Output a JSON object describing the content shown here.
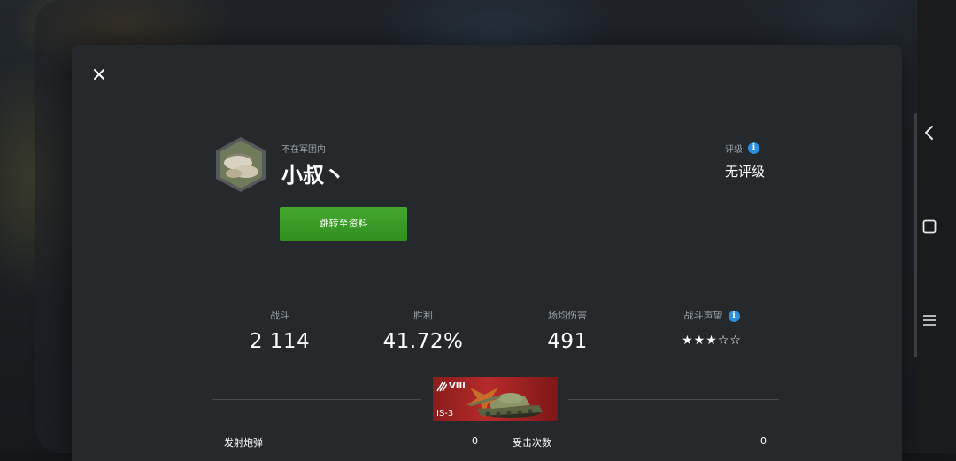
{
  "profile": {
    "clan_status": "不在军团内",
    "player_name": "小叔丶",
    "rating_label": "评级",
    "rating_value": "无评级",
    "goto_profile_label": "跳转至资料"
  },
  "stats": [
    {
      "label": "战斗",
      "value": "2 114"
    },
    {
      "label": "胜利",
      "value": "41.72%"
    },
    {
      "label": "场均伤害",
      "value": "491"
    },
    {
      "label": "战斗声望",
      "stars": "★★★☆☆",
      "star_rating": 3,
      "star_max": 5
    }
  ],
  "tank": {
    "tier": "VIII",
    "name": "IS-3"
  },
  "tank_stats": [
    {
      "label": "发射炮弹",
      "value": "0"
    },
    {
      "label": "受击次数",
      "value": "0"
    }
  ],
  "icons": {
    "close": "close-icon",
    "info": "info-icon",
    "back": "back-icon",
    "home": "home-icon",
    "menu": "menu-icon"
  },
  "colors": {
    "accent_green": "#3c9e28",
    "info_blue": "#2a8fe0",
    "tank_card_red": "#b72a2a"
  }
}
